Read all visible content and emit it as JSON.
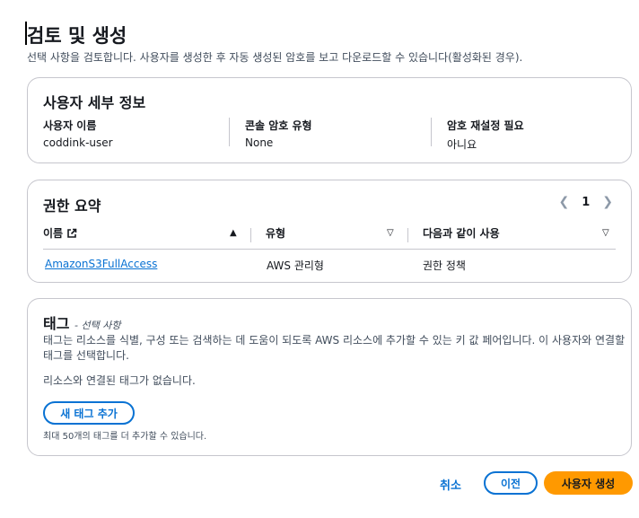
{
  "header": {
    "title": "검토 및 생성",
    "description": "선택 사항을 검토합니다. 사용자를 생성한 후 자동 생성된 암호를 보고 다운로드할 수 있습니다(활성화된 경우)."
  },
  "user_details": {
    "title": "사용자 세부 정보",
    "fields": [
      {
        "label": "사용자 이름",
        "value": "coddink-user"
      },
      {
        "label": "콘솔 암호 유형",
        "value": "None"
      },
      {
        "label": "암호 재설정 필요",
        "value": "아니요"
      }
    ]
  },
  "permissions": {
    "title": "권한 요약",
    "page": "1",
    "columns": [
      "이름",
      "유형",
      "다음과 같이 사용"
    ],
    "rows": [
      {
        "name": "AmazonS3FullAccess",
        "type": "AWS 관리형",
        "used_as": "권한 정책"
      }
    ]
  },
  "tags": {
    "title": "태그",
    "optional": "- 선택 사항",
    "description": "태그는 리소스를 식별, 구성 또는 검색하는 데 도움이 되도록 AWS 리소스에 추가할 수 있는 키 값 페어입니다. 이 사용자와 연결할 태그를 선택합니다.",
    "empty": "리소스와 연결된 태그가 없습니다.",
    "add_button": "새 태그 추가",
    "hint": "최대 50개의 태그를 더 추가할 수 있습니다."
  },
  "footer": {
    "cancel": "취소",
    "previous": "이전",
    "create": "사용자 생성"
  },
  "colors": {
    "link": "#0972d3",
    "primary": "#ff9900",
    "border": "#c6c6cd"
  }
}
